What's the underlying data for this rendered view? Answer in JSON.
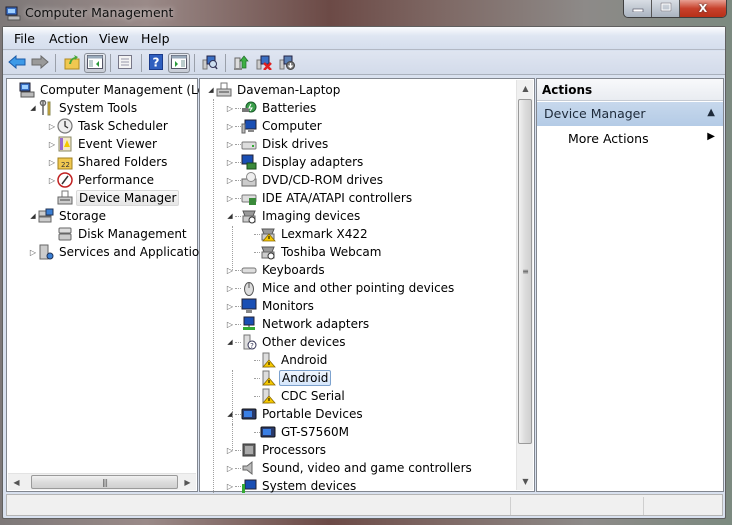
{
  "window": {
    "title": "Computer Management",
    "controls": {
      "minimize": "—",
      "maximize": "□",
      "close": "X"
    }
  },
  "menubar": {
    "items": [
      "File",
      "Action",
      "View",
      "Help"
    ]
  },
  "toolbar": {
    "buttons": [
      {
        "name": "back-arrow-icon"
      },
      {
        "name": "forward-arrow-icon"
      },
      {
        "name": "up-folder-icon"
      },
      {
        "name": "show-hide-console-tree-icon",
        "pressed": true
      },
      {
        "name": "properties-icon"
      },
      {
        "name": "help-icon"
      },
      {
        "name": "show-hide-action-pane-icon",
        "pressed": true
      },
      {
        "name": "scan-hardware-changes-icon"
      },
      {
        "name": "update-driver-icon"
      },
      {
        "name": "uninstall-icon"
      },
      {
        "name": "disable-device-icon"
      }
    ]
  },
  "console_tree": {
    "items": [
      {
        "label": "Computer Management (Local",
        "icon": "computer-management-icon",
        "expander": "",
        "level": 0
      },
      {
        "label": "System Tools",
        "icon": "system-tools-icon",
        "expander": "expanded",
        "level": 1
      },
      {
        "label": "Task Scheduler",
        "icon": "clock-icon",
        "expander": "collapsed",
        "level": 2
      },
      {
        "label": "Event Viewer",
        "icon": "event-viewer-icon",
        "expander": "collapsed",
        "level": 2
      },
      {
        "label": "Shared Folders",
        "icon": "shared-folders-icon",
        "expander": "collapsed",
        "level": 2
      },
      {
        "label": "Performance",
        "icon": "performance-icon",
        "expander": "collapsed",
        "level": 2
      },
      {
        "label": "Device Manager",
        "icon": "device-manager-icon",
        "expander": "",
        "level": 2,
        "selected": true
      },
      {
        "label": "Storage",
        "icon": "storage-icon",
        "expander": "expanded",
        "level": 1
      },
      {
        "label": "Disk Management",
        "icon": "disk-management-icon",
        "expander": "",
        "level": 2
      },
      {
        "label": "Services and Applications",
        "icon": "services-icon",
        "expander": "collapsed",
        "level": 1
      }
    ]
  },
  "device_tree": {
    "items": [
      {
        "label": "Daveman-Laptop",
        "icon": "computer-root-icon",
        "expander": "expanded",
        "level": 0
      },
      {
        "label": "Batteries",
        "icon": "battery-icon",
        "expander": "collapsed",
        "level": 1
      },
      {
        "label": "Computer",
        "icon": "computer-icon",
        "expander": "collapsed",
        "level": 1
      },
      {
        "label": "Disk drives",
        "icon": "disk-drive-icon",
        "expander": "collapsed",
        "level": 1
      },
      {
        "label": "Display adapters",
        "icon": "display-adapter-icon",
        "expander": "collapsed",
        "level": 1
      },
      {
        "label": "DVD/CD-ROM drives",
        "icon": "dvd-drive-icon",
        "expander": "collapsed",
        "level": 1
      },
      {
        "label": "IDE ATA/ATAPI controllers",
        "icon": "ide-controller-icon",
        "expander": "collapsed",
        "level": 1
      },
      {
        "label": "Imaging devices",
        "icon": "imaging-device-icon",
        "expander": "expanded",
        "level": 1
      },
      {
        "label": "Lexmark X422",
        "icon": "imaging-device-warning-icon",
        "expander": "",
        "level": 2,
        "warning": true
      },
      {
        "label": "Toshiba Webcam",
        "icon": "webcam-icon",
        "expander": "",
        "level": 2
      },
      {
        "label": "Keyboards",
        "icon": "keyboard-icon",
        "expander": "collapsed",
        "level": 1
      },
      {
        "label": "Mice and other pointing devices",
        "icon": "mouse-icon",
        "expander": "collapsed",
        "level": 1
      },
      {
        "label": "Monitors",
        "icon": "monitor-icon",
        "expander": "collapsed",
        "level": 1
      },
      {
        "label": "Network adapters",
        "icon": "network-adapter-icon",
        "expander": "collapsed",
        "level": 1
      },
      {
        "label": "Other devices",
        "icon": "unknown-device-icon",
        "expander": "expanded",
        "level": 1
      },
      {
        "label": "Android",
        "icon": "unknown-device-warning-icon",
        "expander": "",
        "level": 2,
        "warning": true
      },
      {
        "label": "Android",
        "icon": "unknown-device-warning-icon",
        "expander": "",
        "level": 2,
        "warning": true,
        "selected": true
      },
      {
        "label": "CDC Serial",
        "icon": "unknown-device-warning-icon",
        "expander": "",
        "level": 2,
        "warning": true
      },
      {
        "label": "Portable Devices",
        "icon": "portable-device-icon",
        "expander": "expanded",
        "level": 1
      },
      {
        "label": "GT-S7560M",
        "icon": "portable-device-icon",
        "expander": "",
        "level": 2
      },
      {
        "label": "Processors",
        "icon": "processor-icon",
        "expander": "collapsed",
        "level": 1
      },
      {
        "label": "Sound, video and game controllers",
        "icon": "sound-icon",
        "expander": "collapsed",
        "level": 1
      },
      {
        "label": "System devices",
        "icon": "system-devices-icon",
        "expander": "collapsed",
        "level": 1
      }
    ],
    "scroll_position_fraction": 0.0
  },
  "actions_pane": {
    "header": "Actions",
    "group_label": "Device Manager",
    "items": [
      {
        "label": "More Actions"
      }
    ]
  },
  "glyphs": {
    "expanded": "◢",
    "collapsed": "▷",
    "up": "▲",
    "right": "▶",
    "scroll_up": "▲",
    "scroll_down": "▼",
    "scroll_left": "◀",
    "scroll_right": "▶",
    "grip_v": "≡",
    "grip_h": "|||"
  },
  "colors": {
    "selection_border": "#7da2ce",
    "actions_group_bg": "#b9cee8",
    "frame_bg": "#d9e1ef",
    "warning_yellow": "#f5c800"
  }
}
